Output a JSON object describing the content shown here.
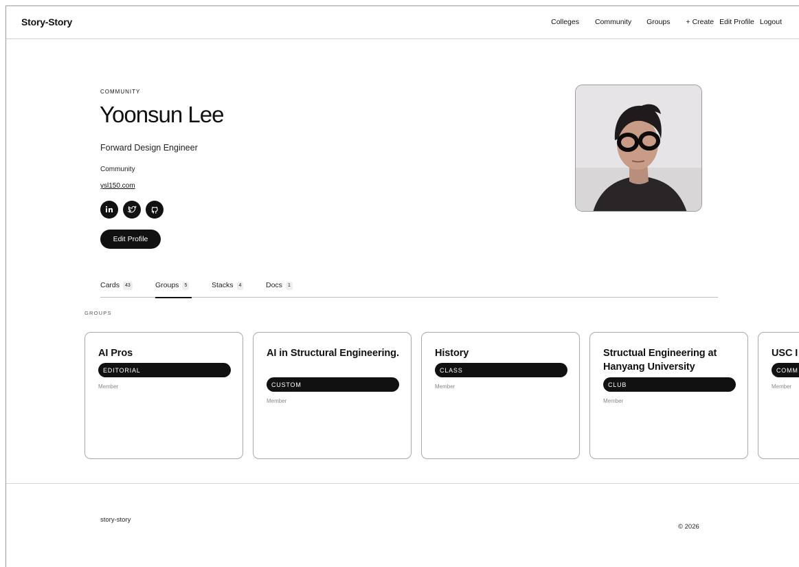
{
  "header": {
    "brand": "Story-Story",
    "nav": {
      "colleges": "Colleges",
      "community": "Community",
      "groups": "Groups",
      "create": "+ Create",
      "edit_profile": "Edit Profile",
      "logout": "Logout"
    }
  },
  "profile": {
    "eyebrow": "COMMUNITY",
    "name": "Yoonsun Lee",
    "role": "Forward Design Engineer",
    "type": "Community",
    "website": "ysl150.com",
    "socials": [
      "linkedin-icon",
      "twitter-icon",
      "github-icon"
    ],
    "edit_button": "Edit Profile"
  },
  "tabs": [
    {
      "label": "Cards",
      "count": "43"
    },
    {
      "label": "Groups",
      "count": "5",
      "active": true
    },
    {
      "label": "Stacks",
      "count": "4"
    },
    {
      "label": "Docs",
      "count": "1"
    }
  ],
  "groups": {
    "section_label": "GROUPS",
    "items": [
      {
        "title": "AI Pros",
        "badge": "EDITORIAL",
        "role": "Member"
      },
      {
        "title": "AI in Structural Engineering.",
        "badge": "CUSTOM",
        "role": "Member"
      },
      {
        "title": "History",
        "badge": "CLASS",
        "role": "Member"
      },
      {
        "title": "Structual Engineering at Hanyang University",
        "badge": "CLUB",
        "role": "Member"
      },
      {
        "title": "USC I",
        "badge": "COMM",
        "role": "Member"
      }
    ]
  },
  "footer": {
    "brand": "story-story",
    "copyright": "© 2026"
  },
  "colors": {
    "accent": "#111111",
    "border": "#a9a9a9",
    "muted": "#888888"
  }
}
